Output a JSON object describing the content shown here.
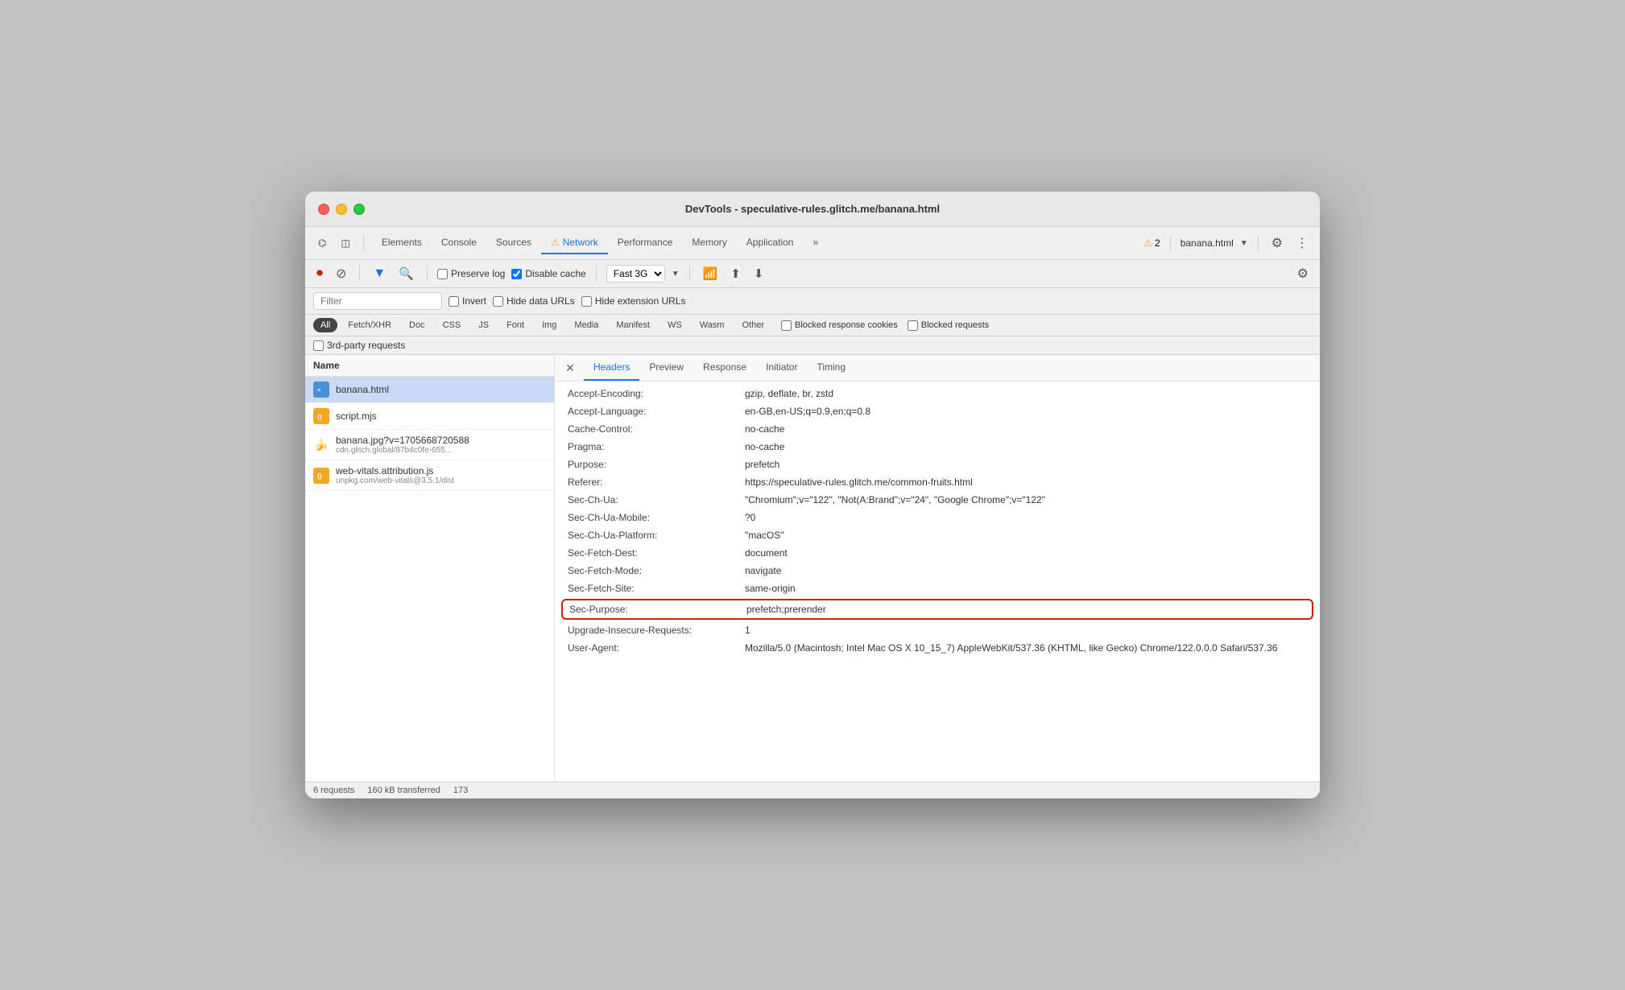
{
  "window": {
    "title": "DevTools - speculative-rules.glitch.me/banana.html"
  },
  "devtools_tabs": [
    {
      "label": "Elements",
      "active": false
    },
    {
      "label": "Console",
      "active": false
    },
    {
      "label": "Sources",
      "active": false
    },
    {
      "label": "Network",
      "active": true,
      "warning": true
    },
    {
      "label": "Performance",
      "active": false
    },
    {
      "label": "Memory",
      "active": false
    },
    {
      "label": "Application",
      "active": false
    },
    {
      "label": "»",
      "active": false
    }
  ],
  "toolbar": {
    "warning_count": "2",
    "current_page": "banana.html",
    "preserve_log": false,
    "disable_cache": true,
    "throttle": "Fast 3G"
  },
  "filter": {
    "placeholder": "Filter",
    "invert": false,
    "hide_data_urls": false,
    "hide_extension_urls": false
  },
  "type_filters": [
    {
      "label": "All",
      "active": true
    },
    {
      "label": "Fetch/XHR",
      "active": false
    },
    {
      "label": "Doc",
      "active": false
    },
    {
      "label": "CSS",
      "active": false
    },
    {
      "label": "JS",
      "active": false
    },
    {
      "label": "Font",
      "active": false
    },
    {
      "label": "Img",
      "active": false
    },
    {
      "label": "Media",
      "active": false
    },
    {
      "label": "Manifest",
      "active": false
    },
    {
      "label": "WS",
      "active": false
    },
    {
      "label": "Wasm",
      "active": false
    },
    {
      "label": "Other",
      "active": false
    }
  ],
  "blocked_filters": {
    "blocked_response_cookies": false,
    "blocked_requests": false
  },
  "third_party": false,
  "request_list": {
    "header": "Name",
    "items": [
      {
        "name": "banana.html",
        "subtext": "",
        "type": "html",
        "selected": true
      },
      {
        "name": "script.mjs",
        "subtext": "",
        "type": "js",
        "selected": false
      },
      {
        "name": "banana.jpg?v=1705668720588",
        "subtext": "cdn.glitch.global/87b4c0fe-655...",
        "type": "img",
        "selected": false
      },
      {
        "name": "web-vitals.attribution.js",
        "subtext": "unpkg.com/web-vitals@3.5.1/dist",
        "type": "js",
        "selected": false
      }
    ]
  },
  "headers_panel": {
    "tabs": [
      {
        "label": "Headers",
        "active": true
      },
      {
        "label": "Preview",
        "active": false
      },
      {
        "label": "Response",
        "active": false
      },
      {
        "label": "Initiator",
        "active": false
      },
      {
        "label": "Timing",
        "active": false
      }
    ],
    "headers": [
      {
        "name": "Accept-Encoding:",
        "value": "gzip, deflate, br, zstd"
      },
      {
        "name": "Accept-Language:",
        "value": "en-GB,en-US;q=0.9,en;q=0.8"
      },
      {
        "name": "Cache-Control:",
        "value": "no-cache"
      },
      {
        "name": "Pragma:",
        "value": "no-cache"
      },
      {
        "name": "Purpose:",
        "value": "prefetch"
      },
      {
        "name": "Referer:",
        "value": "https://speculative-rules.glitch.me/common-fruits.html"
      },
      {
        "name": "Sec-Ch-Ua:",
        "value": "\"Chromium\";v=\"122\", \"Not(A:Brand\";v=\"24\", \"Google Chrome\";v=\"122\""
      },
      {
        "name": "Sec-Ch-Ua-Mobile:",
        "value": "?0"
      },
      {
        "name": "Sec-Ch-Ua-Platform:",
        "value": "\"macOS\""
      },
      {
        "name": "Sec-Fetch-Dest:",
        "value": "document"
      },
      {
        "name": "Sec-Fetch-Mode:",
        "value": "navigate"
      },
      {
        "name": "Sec-Fetch-Site:",
        "value": "same-origin"
      },
      {
        "name": "Sec-Purpose:",
        "value": "prefetch;prerender",
        "highlighted": true
      },
      {
        "name": "Upgrade-Insecure-Requests:",
        "value": "1"
      },
      {
        "name": "User-Agent:",
        "value": "Mozilla/5.0 (Macintosh; Intel Mac OS X 10_15_7) AppleWebKit/537.36 (KHTML, like Gecko) Chrome/122.0.0.0 Safari/537.36"
      }
    ]
  },
  "status_bar": {
    "requests": "6 requests",
    "transferred": "160 kB transferred",
    "other": "173"
  }
}
